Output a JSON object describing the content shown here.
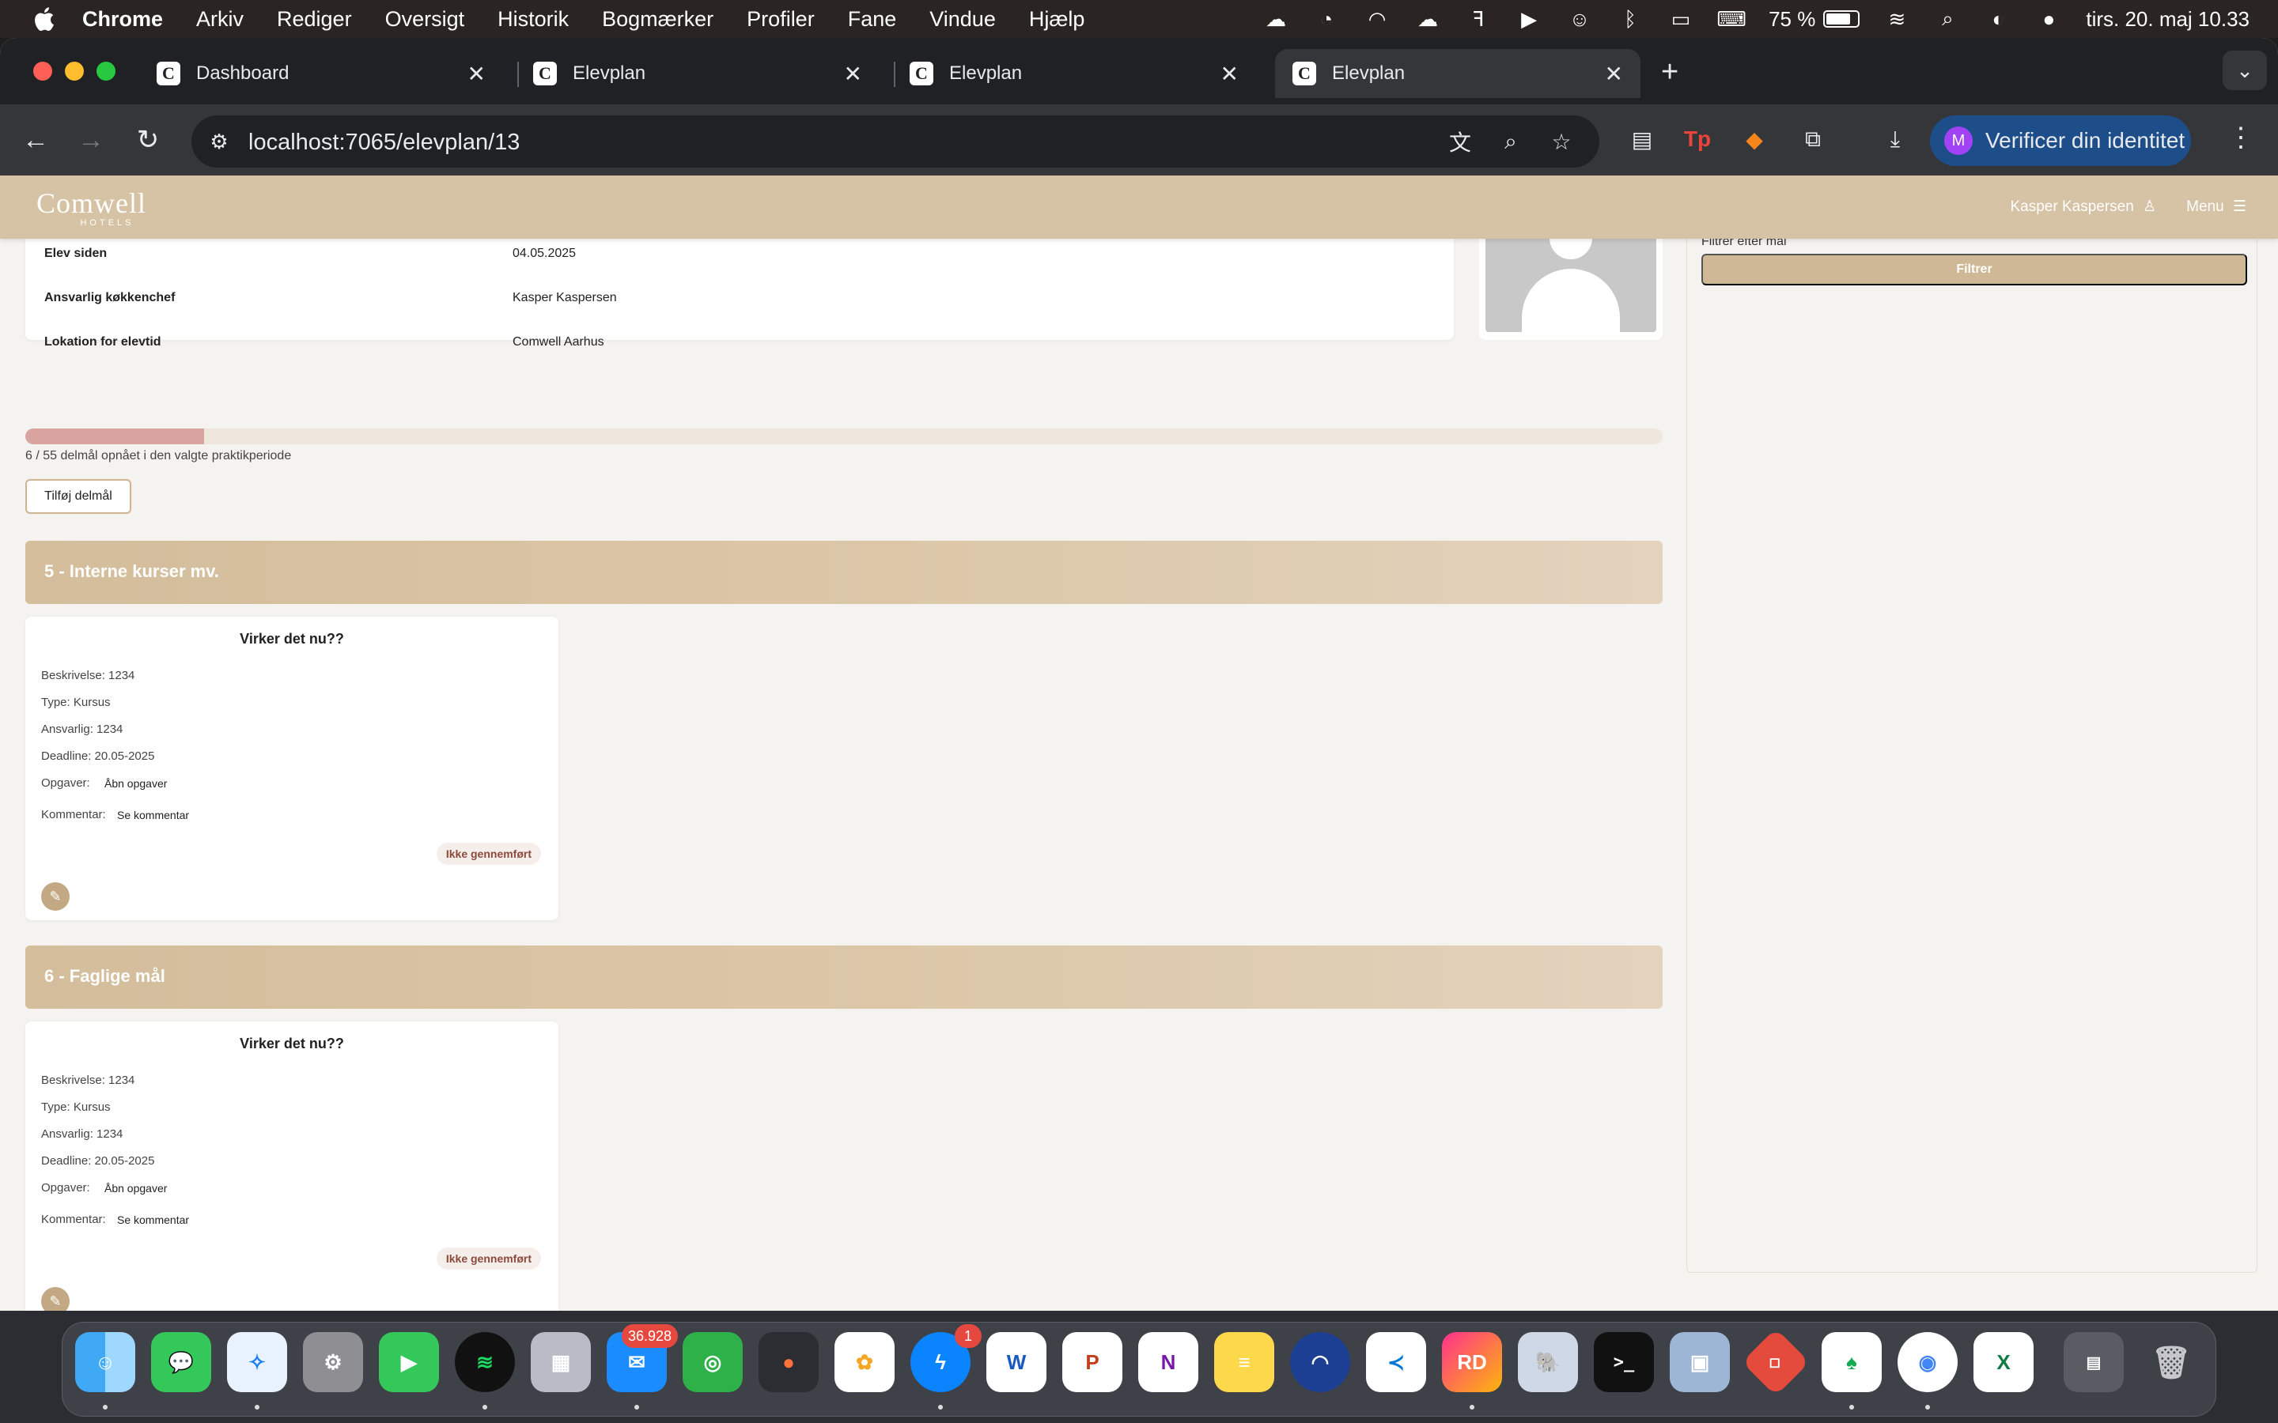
{
  "menubar": {
    "app": "Chrome",
    "items": [
      "Arkiv",
      "Rediger",
      "Oversigt",
      "Historik",
      "Bogmærker",
      "Profiler",
      "Fane",
      "Vindue",
      "Hjælp"
    ],
    "battery": "75 %",
    "clock": "tirs. 20. maj  10.33"
  },
  "browser": {
    "tabs": [
      {
        "title": "Dashboard"
      },
      {
        "title": "Elevplan"
      },
      {
        "title": "Elevplan"
      },
      {
        "title": "Elevplan"
      }
    ],
    "active_tab": 3,
    "url": "localhost:7065/elevplan/13",
    "verify_label": "Verificer din identitet",
    "profile_initial": "M"
  },
  "site": {
    "logo": "Comwell",
    "logo_sub": "HOTELS",
    "user": "Kasper Kaspersen",
    "menu": "Menu"
  },
  "student_info": {
    "rows": [
      {
        "label": "Elev siden",
        "value": "04.05.2025"
      },
      {
        "label": "Ansvarlig køkkenchef",
        "value": "Kasper Kaspersen"
      },
      {
        "label": "Lokation for elevtid",
        "value": "Comwell Aarhus"
      }
    ]
  },
  "progress": {
    "achieved": 6,
    "total": 55,
    "text": "6 / 55 delmål opnået i den valgte praktikperiode"
  },
  "add_goal_button": "Tilføj delmål",
  "sections": [
    {
      "title": "5 - Interne kurser mv.",
      "card": {
        "title": "Virker det nu??",
        "description": "Beskrivelse: 1234",
        "type": "Type: Kursus",
        "responsible": "Ansvarlig: 1234",
        "deadline": "Deadline: 20.05-2025",
        "tasks_label": "Opgaver:",
        "tasks_link": "Åbn opgaver",
        "comment_label": "Kommentar:",
        "comment_link": "Se kommentar",
        "status": "Ikke gennemført"
      }
    },
    {
      "title": "6 - Faglige mål",
      "card": {
        "title": "Virker det nu??",
        "description": "Beskrivelse: 1234",
        "type": "Type: Kursus",
        "responsible": "Ansvarlig: 1234",
        "deadline": "Deadline: 20.05-2025",
        "tasks_label": "Opgaver:",
        "tasks_link": "Åbn opgaver",
        "comment_label": "Kommentar:",
        "comment_link": "Se kommentar",
        "status": "Ikke gennemført"
      }
    }
  ],
  "filter": {
    "label": "Filtrer efter mål",
    "button": "Filtrer"
  },
  "dock": {
    "mail_badge": "36.928",
    "messenger_badge": "1",
    "icons": [
      "finder-icon",
      "messages-icon",
      "safari-icon",
      "system-settings-icon",
      "facetime-icon",
      "spotify-icon",
      "launchpad-icon",
      "mail-icon",
      "find-my-icon",
      "firefox-icon",
      "photos-icon",
      "messenger-icon",
      "word-icon",
      "powerpoint-icon",
      "onenote-icon",
      "notes-icon",
      "network-icon",
      "vscode-icon",
      "rider-icon",
      "postgres-icon",
      "terminal-icon",
      "preview-icon",
      "git-icon",
      "mongodb-icon",
      "chrome-icon",
      "excel-icon",
      "downloads-stack-icon",
      "trash-icon"
    ]
  },
  "colors": {
    "header": "#d6c2a4",
    "accent": "#cfb896",
    "progress_fill": "#d9a4a0",
    "status_text": "#8a4a3c"
  }
}
